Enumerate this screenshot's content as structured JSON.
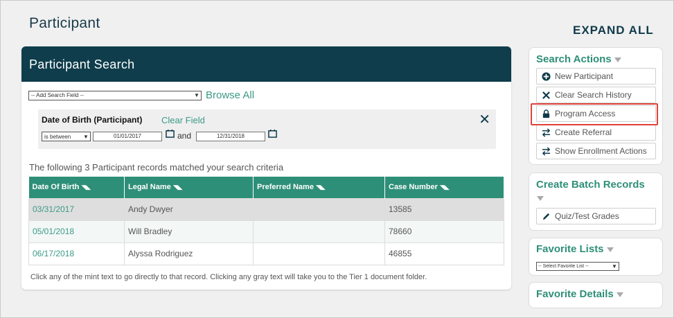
{
  "page": {
    "title": "Participant",
    "expand_all": "EXPAND ALL"
  },
  "search": {
    "header": "Participant Search",
    "add_field_selected": "-- Add Search Field --",
    "browse_all": "Browse All",
    "filter": {
      "label": "Date of Birth (Participant)",
      "clear_field": "Clear Field",
      "operator": "is between",
      "from": "01/01/2017",
      "and_label": "and",
      "to": "12/31/2018"
    },
    "result_text": "The following 3 Participant records matched your search criteria",
    "columns": [
      "Date Of Birth",
      "Legal Name",
      "Preferred Name",
      "Case Number"
    ],
    "rows": [
      {
        "dob": "03/31/2017",
        "legal": "Andy Dwyer",
        "preferred": "",
        "case": "13585"
      },
      {
        "dob": "05/01/2018",
        "legal": "Will Bradley",
        "preferred": "",
        "case": "78660"
      },
      {
        "dob": "06/17/2018",
        "legal": "Alyssa Rodriguez",
        "preferred": "",
        "case": "46855"
      }
    ],
    "footer_note": "Click any of the mint text to go directly to that record. Clicking any gray text will take you to the Tier 1 document folder."
  },
  "sidebar": {
    "search_actions": {
      "title": "Search Actions",
      "buttons": [
        "New Participant",
        "Clear Search History",
        "Program Access",
        "Create Referral",
        "Show Enrollment Actions"
      ]
    },
    "batch": {
      "title": "Create Batch Records",
      "button": "Quiz/Test Grades"
    },
    "favorite_lists": {
      "title": "Favorite Lists",
      "select": "-- Select Favorite List --"
    },
    "favorite_details": {
      "title": "Favorite Details"
    }
  },
  "colors": {
    "header_bg": "#0f3d4c",
    "accent": "#2e8f78",
    "mint_text": "#3c9a86",
    "highlight": "#e0423a"
  }
}
